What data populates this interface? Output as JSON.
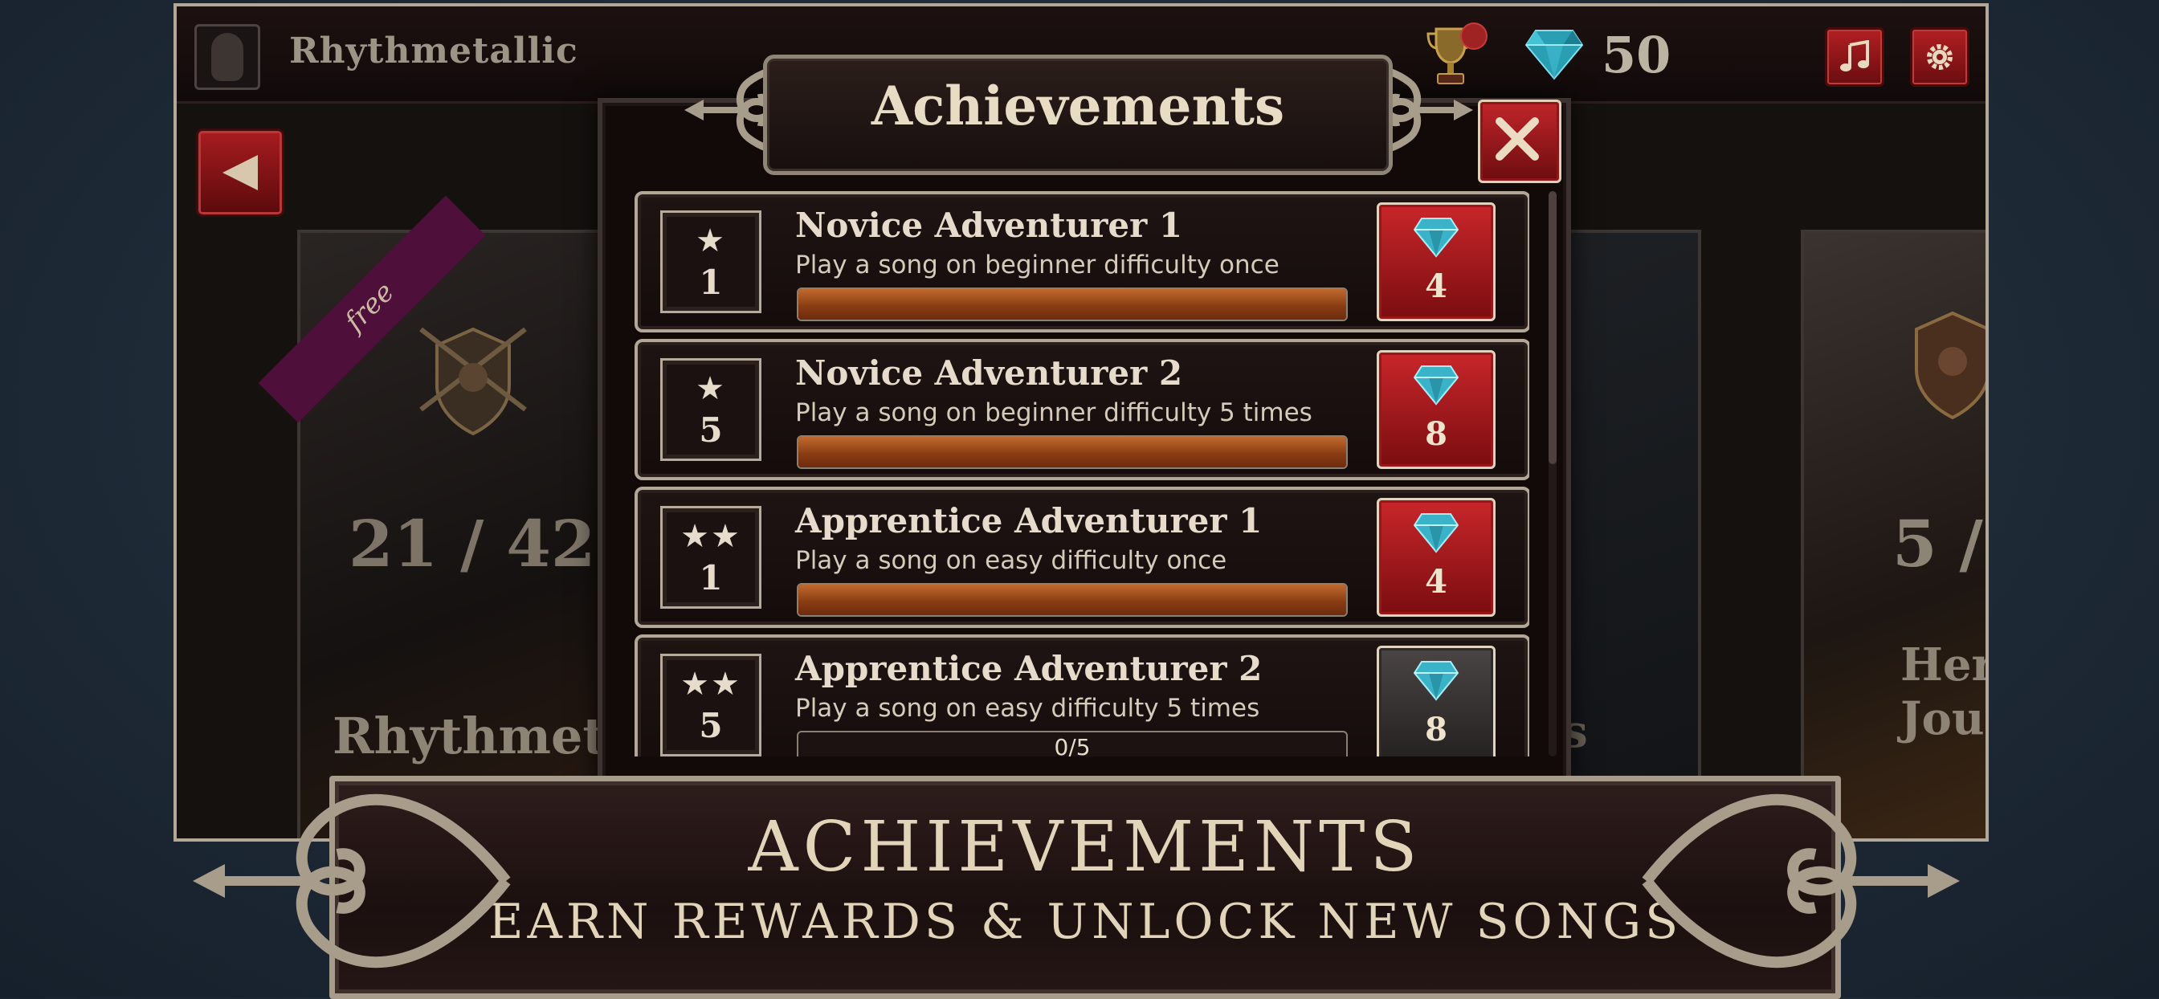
{
  "colors": {
    "accent_red": "#b11f22",
    "gold_text": "#e2d4b9",
    "progress_orange": "#c06a2e",
    "frame": "#b3a898"
  },
  "header": {
    "username": "Rhythmetallic",
    "avatar_icon": "silhouette-avatar-icon",
    "trophy_icon": "trophy-icon",
    "gem_icon": "diamond-icon",
    "gem_count": "50",
    "music_button_icon": "music-note-icon",
    "settings_button_icon": "gear-icon"
  },
  "background_cards": {
    "left": {
      "ribbon": "free",
      "progress": "21 / 42",
      "name": "Rhythmetall"
    },
    "middle": {
      "name": "is"
    },
    "right": {
      "progress": "5 /",
      "name": "Her\nJour"
    }
  },
  "modal": {
    "title": "Achievements",
    "close_icon": "close-icon",
    "achievements": [
      {
        "name": "Novice Adventurer 1",
        "description": "Play a song on beginner difficulty once",
        "stars": "★",
        "rank_number": "1",
        "progress": 1.0,
        "progress_text": "",
        "reward": "4",
        "reward_state": "claimable"
      },
      {
        "name": "Novice Adventurer 2",
        "description": "Play a song on beginner difficulty 5 times",
        "stars": "★",
        "rank_number": "5",
        "progress": 1.0,
        "progress_text": "",
        "reward": "8",
        "reward_state": "claimable"
      },
      {
        "name": "Apprentice Adventurer 1",
        "description": "Play a song on easy difficulty once",
        "stars": "★★",
        "rank_number": "1",
        "progress": 1.0,
        "progress_text": "",
        "reward": "4",
        "reward_state": "claimable"
      },
      {
        "name": "Apprentice Adventurer 2",
        "description": "Play a song on easy difficulty 5 times",
        "stars": "★★",
        "rank_number": "5",
        "progress": 0.0,
        "progress_text": "0/5",
        "reward": "8",
        "reward_state": "locked"
      }
    ]
  },
  "banner": {
    "title": "ACHIEVEMENTS",
    "subtitle": "EARN REWARDS & UNLOCK NEW SONGS"
  }
}
